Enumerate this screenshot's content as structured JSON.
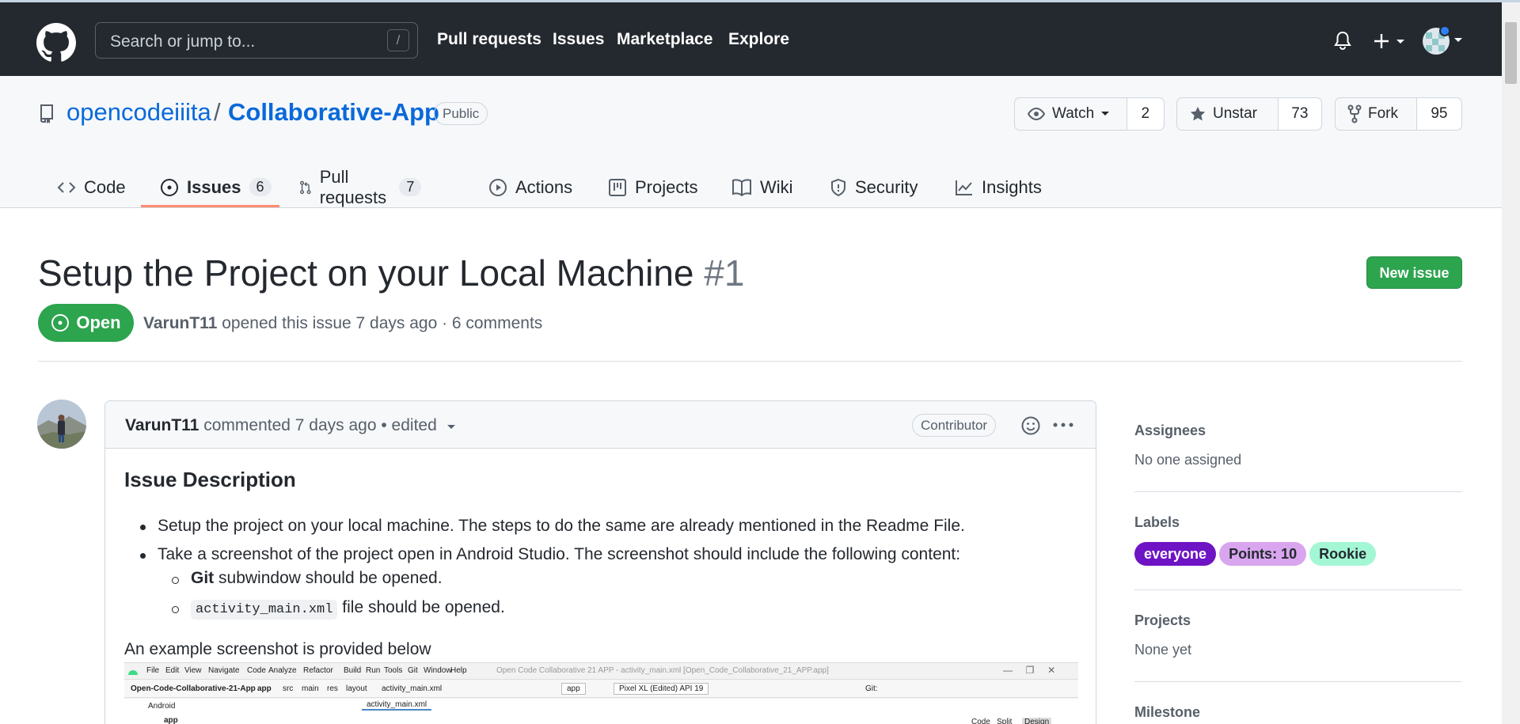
{
  "header": {
    "search_placeholder": "Search or jump to...",
    "search_shortcut": "/",
    "nav": [
      "Pull requests",
      "Issues",
      "Marketplace",
      "Explore"
    ]
  },
  "repo": {
    "owner": "opencodeiiita",
    "separator": "/",
    "name": "Collaborative-App",
    "visibility": "Public",
    "watch_label": "Watch",
    "watch_count": "2",
    "star_label": "Unstar",
    "star_count": "73",
    "fork_label": "Fork",
    "fork_count": "95"
  },
  "tabs": [
    {
      "label": "Code",
      "icon": "code-icon"
    },
    {
      "label": "Issues",
      "count": "6",
      "icon": "issue-opened-icon",
      "active": true
    },
    {
      "label": "Pull requests",
      "count": "7",
      "icon": "git-pull-request-icon"
    },
    {
      "label": "Actions",
      "icon": "play-icon"
    },
    {
      "label": "Projects",
      "icon": "table-icon"
    },
    {
      "label": "Wiki",
      "icon": "book-icon"
    },
    {
      "label": "Security",
      "icon": "shield-icon"
    },
    {
      "label": "Insights",
      "icon": "graph-icon"
    }
  ],
  "issue": {
    "title": "Setup the Project on your Local Machine",
    "number": "#1",
    "new_issue_label": "New issue",
    "state": "Open",
    "author": "VarunT11",
    "meta_text": "opened this issue 7 days ago · 6 comments"
  },
  "comment": {
    "author": "VarunT11",
    "meta": "commented 7 days ago • edited",
    "badge": "Contributor",
    "heading": "Issue Description",
    "bullet1": "Setup the project on your local machine. The steps to do the same are already mentioned in the Readme File.",
    "bullet2": "Take a screenshot of the project open in Android Studio. The screenshot should include the following content:",
    "sub1_bold": "Git",
    "sub1_rest": "subwindow should be opened.",
    "sub2_code": "activity_main.xml",
    "sub2_rest": "file should be opened.",
    "example_text": "An example screenshot is provided below"
  },
  "embedded_screenshot": {
    "menu": [
      "File",
      "Edit",
      "View",
      "Navigate",
      "Code",
      "Analyze",
      "Refactor",
      "Build",
      "Run",
      "Tools",
      "Git",
      "Window",
      "Help"
    ],
    "window_title": "Open Code Collaborative 21 APP - activity_main.xml [Open_Code_Collaborative_21_APP.app]",
    "breadcrumb": [
      "Open-Code-Collaborative-21-App",
      "app",
      "src",
      "main",
      "res",
      "layout",
      "activity_main.xml"
    ],
    "run_config": "app",
    "device": "Pixel XL (Edited) API 19",
    "git_label": "Git:",
    "project_view": "Android",
    "tab": "activity_main.xml",
    "tree_item": "app",
    "view_modes": [
      "Code",
      "Split",
      "Design"
    ]
  },
  "sidebar": {
    "assignees_title": "Assignees",
    "assignees_value": "No one assigned",
    "labels_title": "Labels",
    "labels": [
      {
        "name": "everyone",
        "bg": "#6e14c4",
        "fg": "#ffffff"
      },
      {
        "name": "Points: 10",
        "bg": "#d8a5ee",
        "fg": "#24292f"
      },
      {
        "name": "Rookie",
        "bg": "#a3f7d4",
        "fg": "#24292f"
      }
    ],
    "projects_title": "Projects",
    "projects_value": "None yet",
    "milestone_title": "Milestone"
  },
  "colors": {
    "header_bg": "#24292f",
    "link": "#0969da",
    "open_green": "#2da44e",
    "tab_underline": "#fd8c73"
  }
}
